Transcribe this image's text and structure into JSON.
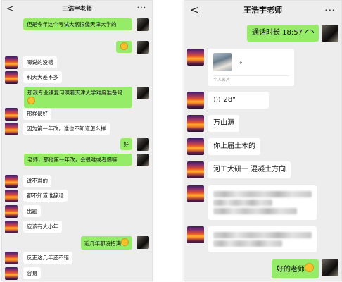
{
  "left": {
    "title": "王浩宇老师",
    "back_icon": "chevron-left-icon",
    "more_icon": "more-dots-icon",
    "more_label": "···",
    "back_label": "<",
    "messages": [
      {
        "dir": "out",
        "text": "但是今年这个考试大纲很像天津大学的"
      },
      {
        "dir": "out",
        "text": "",
        "emoji": "smile-emoji"
      },
      {
        "dir": "in",
        "text": "嗯说的没错"
      },
      {
        "dir": "in",
        "text": "和天大差不多"
      },
      {
        "dir": "out",
        "text": "那我专业课复习照着天津大学难度准备吗",
        "emoji": "smile-emoji"
      },
      {
        "dir": "in",
        "text": "那样最好"
      },
      {
        "dir": "in",
        "text": "因为第一年改，谁也不知道怎么样"
      },
      {
        "dir": "out",
        "text": "好"
      },
      {
        "dir": "out",
        "text": "老师，那他第一年改，会很难或者爆嘛"
      },
      {
        "dir": "in",
        "text": "说不准的"
      },
      {
        "dir": "in",
        "text": "都不知道谁辞退"
      },
      {
        "dir": "in",
        "text": "出题"
      },
      {
        "dir": "in",
        "text": "应该有大小年"
      },
      {
        "dir": "out",
        "text": "近几年都没招满",
        "emoji": "sweat-emoji"
      },
      {
        "dir": "in",
        "text": "反正这几年还不错"
      },
      {
        "dir": "in",
        "text": "容易"
      }
    ]
  },
  "right": {
    "title": "王浩宇老师",
    "back_label": "<",
    "more_label": "···",
    "messages": [
      {
        "dir": "out",
        "type": "call",
        "text": "通话时长 18:57"
      },
      {
        "dir": "in",
        "type": "card",
        "text": "。",
        "footer": "个人名片"
      },
      {
        "dir": "in",
        "type": "voice",
        "text": "28\""
      },
      {
        "dir": "in",
        "text": "万山源"
      },
      {
        "dir": "in",
        "text": "你上届土木的"
      },
      {
        "dir": "in",
        "text": "河工大研一 混凝土方向"
      },
      {
        "dir": "in",
        "type": "blurred"
      },
      {
        "dir": "in",
        "type": "blurred"
      },
      {
        "dir": "out",
        "text": "好的老师",
        "emoji": "sweat-emoji"
      }
    ]
  }
}
